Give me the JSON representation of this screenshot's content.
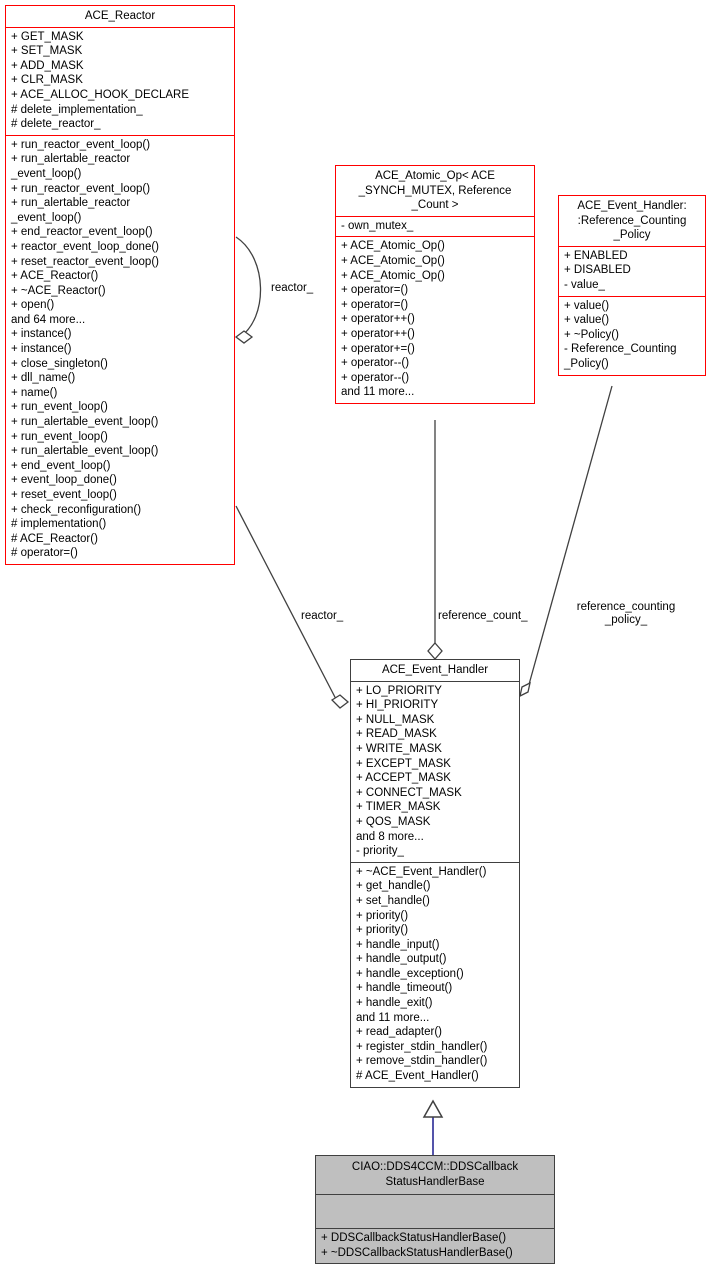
{
  "diagram": {
    "type": "uml-class-diagram",
    "background": "#ffffff",
    "colors": {
      "class_border_red": "#ff0000",
      "class_border_gray": "#404040",
      "class_fill_white": "#ffffff",
      "class_fill_gray": "#bfbfbf",
      "edge": "#404040",
      "inheritance_edge": "#4040a0",
      "text": "#000000"
    }
  },
  "classes": {
    "ace_reactor": {
      "title": "ACE_Reactor",
      "attributes": [
        "+ GET_MASK",
        "+ SET_MASK",
        "+ ADD_MASK",
        "+ CLR_MASK",
        "+ ACE_ALLOC_HOOK_DECLARE",
        "# delete_implementation_",
        "# delete_reactor_"
      ],
      "operations": [
        "+ run_reactor_event_loop()",
        "+ run_alertable_reactor",
        "_event_loop()",
        "+ run_reactor_event_loop()",
        "+ run_alertable_reactor",
        "_event_loop()",
        "+ end_reactor_event_loop()",
        "+ reactor_event_loop_done()",
        "+ reset_reactor_event_loop()",
        "+ ACE_Reactor()",
        "+ ~ACE_Reactor()",
        "+ open()",
        "and 64 more...",
        "+ instance()",
        "+ instance()",
        "+ close_singleton()",
        "+ dll_name()",
        "+ name()",
        "+ run_event_loop()",
        "+ run_alertable_event_loop()",
        "+ run_event_loop()",
        "+ run_alertable_event_loop()",
        "+ end_event_loop()",
        "+ event_loop_done()",
        "+ reset_event_loop()",
        "+ check_reconfiguration()",
        "# implementation()",
        "# ACE_Reactor()",
        "# operator=()"
      ]
    },
    "ace_atomic_op": {
      "title": "ACE_Atomic_Op< ACE\n_SYNCH_MUTEX, Reference\n_Count >",
      "attributes": [
        "- own_mutex_"
      ],
      "operations": [
        "+ ACE_Atomic_Op()",
        "+ ACE_Atomic_Op()",
        "+ ACE_Atomic_Op()",
        "+ operator=()",
        "+ operator=()",
        "+ operator++()",
        "+ operator++()",
        "+ operator+=()",
        "+ operator--()",
        "+ operator--()",
        "and 11 more..."
      ]
    },
    "reference_counting_policy": {
      "title": "ACE_Event_Handler:\n:Reference_Counting\n_Policy",
      "attributes": [
        "+ ENABLED",
        "+ DISABLED",
        "- value_"
      ],
      "operations": [
        "+ value()",
        "+ value()",
        "+ ~Policy()",
        "- Reference_Counting",
        "_Policy()"
      ]
    },
    "ace_event_handler": {
      "title": "ACE_Event_Handler",
      "attributes": [
        "+ LO_PRIORITY",
        "+ HI_PRIORITY",
        "+ NULL_MASK",
        "+ READ_MASK",
        "+ WRITE_MASK",
        "+ EXCEPT_MASK",
        "+ ACCEPT_MASK",
        "+ CONNECT_MASK",
        "+ TIMER_MASK",
        "+ QOS_MASK",
        "and 8 more...",
        "- priority_"
      ],
      "operations": [
        "+ ~ACE_Event_Handler()",
        "+ get_handle()",
        "+ set_handle()",
        "+ priority()",
        "+ priority()",
        "+ handle_input()",
        "+ handle_output()",
        "+ handle_exception()",
        "+ handle_timeout()",
        "+ handle_exit()",
        "and 11 more...",
        "+ read_adapter()",
        "+ register_stdin_handler()",
        "+ remove_stdin_handler()",
        "# ACE_Event_Handler()"
      ]
    },
    "dds_callback_status_handler_base": {
      "title": "CIAO::DDS4CCM::DDSCallback\nStatusHandlerBase",
      "attributes": [],
      "operations": [
        "+ DDSCallbackStatusHandlerBase()",
        "+ ~DDSCallbackStatusHandlerBase()"
      ]
    }
  },
  "edge_labels": {
    "reactor_self": "reactor_",
    "reactor_to_event_handler": "reactor_",
    "reference_count": "reference_count_",
    "reference_counting_policy": "reference_counting\n_policy_"
  }
}
